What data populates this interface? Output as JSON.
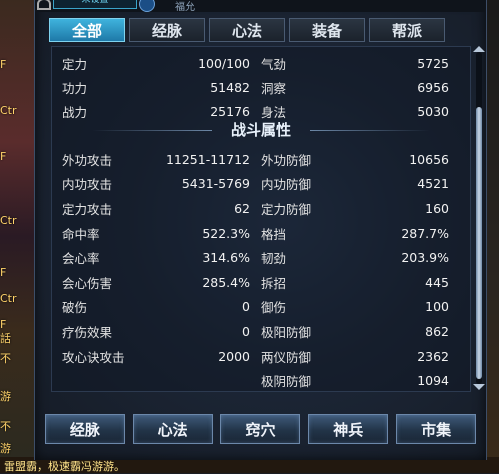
{
  "topbar": {
    "slot_label": "未设置",
    "title_fragment": "福允"
  },
  "tabs": [
    "全部",
    "经脉",
    "心法",
    "装备",
    "帮派"
  ],
  "base_stats": [
    {
      "label": "定力",
      "value": "100/100"
    },
    {
      "label": "气劲",
      "value": "5725"
    },
    {
      "label": "功力",
      "value": "51482"
    },
    {
      "label": "洞察",
      "value": "6956"
    },
    {
      "label": "战力",
      "value": "25176"
    },
    {
      "label": "身法",
      "value": "5030"
    }
  ],
  "combat_section_title": "战斗属性",
  "combat_stats": [
    {
      "label": "外功攻击",
      "value": "11251-11712"
    },
    {
      "label": "外功防御",
      "value": "10656"
    },
    {
      "label": "内功攻击",
      "value": "5431-5769"
    },
    {
      "label": "内功防御",
      "value": "4521"
    },
    {
      "label": "定力攻击",
      "value": "62"
    },
    {
      "label": "定力防御",
      "value": "160"
    },
    {
      "label": "命中率",
      "value": "522.3%"
    },
    {
      "label": "格挡",
      "value": "287.7%"
    },
    {
      "label": "会心率",
      "value": "314.6%"
    },
    {
      "label": "韧劲",
      "value": "203.9%"
    },
    {
      "label": "会心伤害",
      "value": "285.4%"
    },
    {
      "label": "拆招",
      "value": "445"
    },
    {
      "label": "破伤",
      "value": "0"
    },
    {
      "label": "御伤",
      "value": "100"
    },
    {
      "label": "疗伤效果",
      "value": "0"
    },
    {
      "label": "极阳防御",
      "value": "862"
    },
    {
      "label": "攻心诀攻击",
      "value": "2000"
    },
    {
      "label": "两仪防御",
      "value": "2362"
    },
    {
      "label": "",
      "value": ""
    },
    {
      "label": "极阴防御",
      "value": "1094"
    }
  ],
  "bottom_buttons": [
    "经脉",
    "心法",
    "窍穴",
    "神兵",
    "市集"
  ],
  "background": {
    "left_tags": [
      "F",
      "Ctr",
      "F",
      "Ctr",
      "F",
      "Ctr",
      "F",
      "話",
      "不",
      "游",
      "不",
      "游"
    ],
    "bottom_text": "雷盟霸，极速霸冯游游。"
  }
}
